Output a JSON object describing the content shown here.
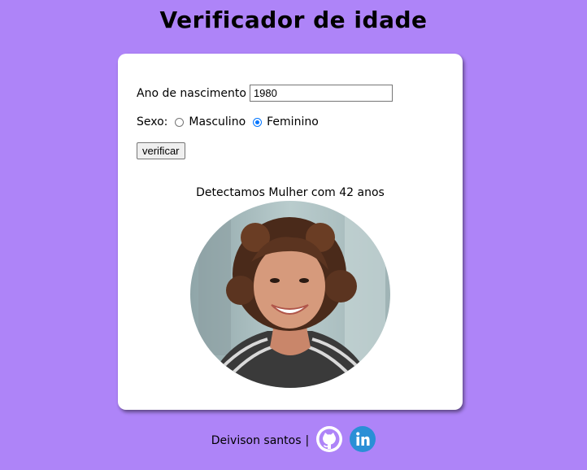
{
  "page": {
    "title": "Verificador de idade"
  },
  "form": {
    "year_label": "Ano de nascimento",
    "year_value": "1980",
    "sex_label": "Sexo:",
    "option_male": "Masculino",
    "option_female": "Feminino",
    "selected": "Feminino",
    "button_label": "verificar"
  },
  "result": {
    "text": "Detectamos Mulher com 42 anos",
    "photo": "portrait-photo-woman"
  },
  "footer": {
    "author": "Deivison santos",
    "separator": "|",
    "icons": [
      "github-icon",
      "linkedin-icon"
    ]
  },
  "colors": {
    "background": "#ae84f8",
    "card": "#ffffff",
    "radio_accent": "#0075ff",
    "linkedin": "#2a8fd6"
  }
}
